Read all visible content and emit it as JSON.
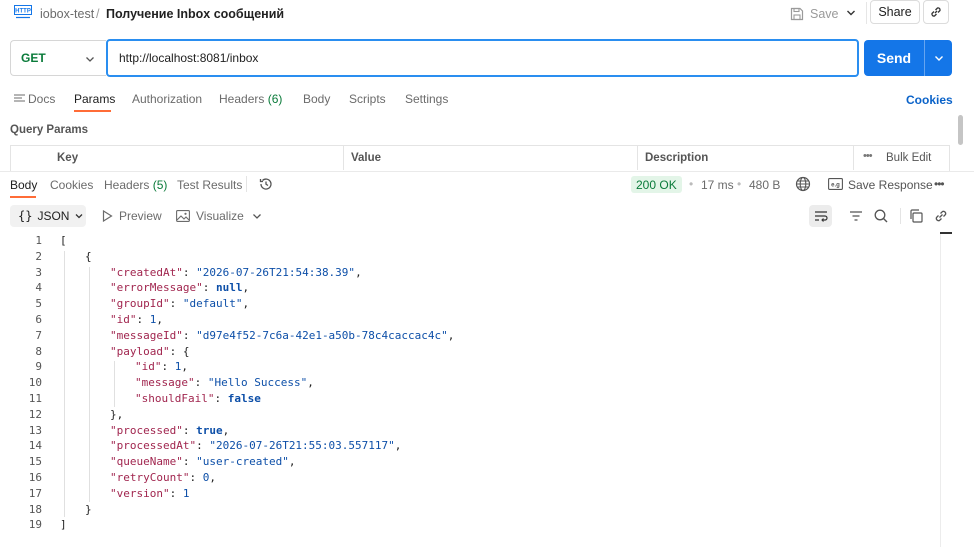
{
  "header": {
    "collection": "iobox-test",
    "separator": "/",
    "title": "Получение Inbox сообщений",
    "save_label": "Save",
    "share_label": "Share"
  },
  "request": {
    "method": "GET",
    "url": "http://localhost:8081/inbox",
    "send_label": "Send",
    "tabs": [
      {
        "label": "Docs"
      },
      {
        "label": "Params"
      },
      {
        "label": "Authorization"
      },
      {
        "label": "Headers",
        "count": "(6)"
      },
      {
        "label": "Body"
      },
      {
        "label": "Scripts"
      },
      {
        "label": "Settings"
      }
    ],
    "active_tab": "Params",
    "cookies_label": "Cookies",
    "query_params_title": "Query Params",
    "columns": [
      "Key",
      "Value",
      "Description"
    ],
    "bulk_edit_label": "Bulk Edit"
  },
  "response": {
    "tabs": [
      {
        "label": "Body"
      },
      {
        "label": "Cookies"
      },
      {
        "label": "Headers",
        "count": "(5)"
      },
      {
        "label": "Test Results"
      }
    ],
    "active_tab": "Body",
    "status": "200 OK",
    "time": "17 ms",
    "size": "480 B",
    "save_response_label": "Save Response",
    "format": "JSON",
    "preview_label": "Preview",
    "visualize_label": "Visualize"
  },
  "code_lines": [
    {
      "ln": "1",
      "text": "["
    },
    {
      "ln": "2",
      "text": "{"
    },
    {
      "ln": "3",
      "key": "\"createdAt\"",
      "value": "\"2026-07-26T21:54:38.39\"",
      "type": "s",
      "tail": ","
    },
    {
      "ln": "4",
      "key": "\"errorMessage\"",
      "value": "null",
      "type": "kw",
      "tail": ","
    },
    {
      "ln": "5",
      "key": "\"groupId\"",
      "value": "\"default\"",
      "type": "s",
      "tail": ","
    },
    {
      "ln": "6",
      "key": "\"id\"",
      "value": "1",
      "type": "n",
      "tail": ","
    },
    {
      "ln": "7",
      "key": "\"messageId\"",
      "value": "\"d97e4f52-7c6a-42e1-a50b-78c4caccac4c\"",
      "type": "s",
      "tail": ","
    },
    {
      "ln": "8",
      "key": "\"payload\"",
      "value": "{",
      "type": "p",
      "tail": ""
    },
    {
      "ln": "9",
      "key": "\"id\"",
      "value": "1",
      "type": "n",
      "tail": ","
    },
    {
      "ln": "10",
      "key": "\"message\"",
      "value": "\"Hello Success\"",
      "type": "s",
      "tail": ","
    },
    {
      "ln": "11",
      "key": "\"shouldFail\"",
      "value": "false",
      "type": "kw",
      "tail": ""
    },
    {
      "ln": "12",
      "text": "},"
    },
    {
      "ln": "13",
      "key": "\"processed\"",
      "value": "true",
      "type": "kw",
      "tail": ","
    },
    {
      "ln": "14",
      "key": "\"processedAt\"",
      "value": "\"2026-07-26T21:55:03.557117\"",
      "type": "s",
      "tail": ","
    },
    {
      "ln": "15",
      "key": "\"queueName\"",
      "value": "\"user-created\"",
      "type": "s",
      "tail": ","
    },
    {
      "ln": "16",
      "key": "\"retryCount\"",
      "value": "0",
      "type": "n",
      "tail": ","
    },
    {
      "ln": "17",
      "key": "\"version\"",
      "value": "1",
      "type": "n",
      "tail": ""
    },
    {
      "ln": "18",
      "text": "}"
    },
    {
      "ln": "19",
      "text": "]"
    }
  ],
  "colors": {
    "accent": "#1476e8",
    "active_tab_underline": "#ff6c37",
    "status_ok": "#0a7b3a",
    "json_key": "#a1264f",
    "json_value": "#0d4fa8"
  }
}
